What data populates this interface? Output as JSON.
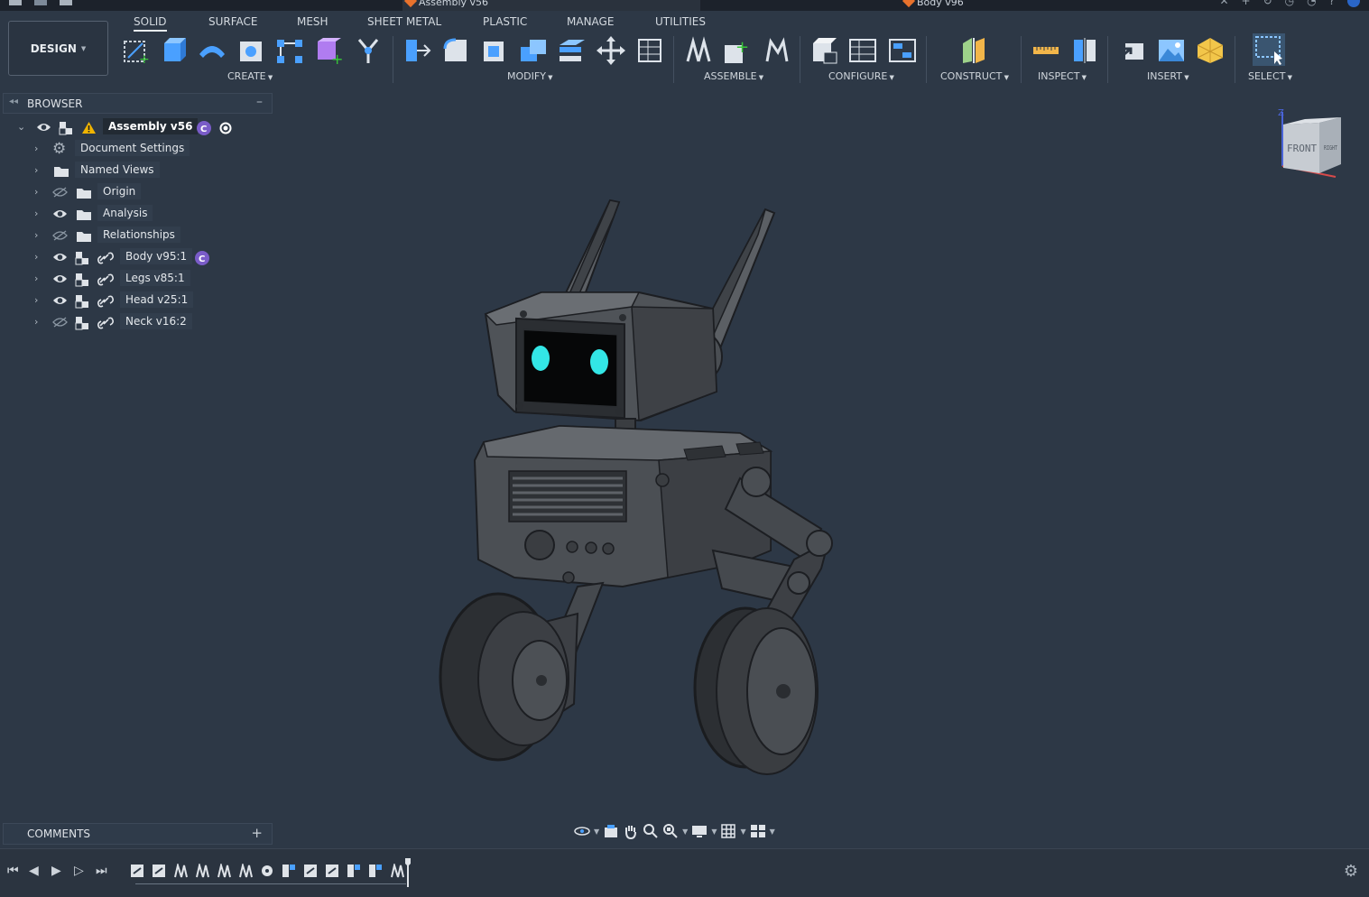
{
  "titlebar": {
    "tabs": [
      {
        "label": "Assembly v56",
        "active": true
      },
      {
        "label": "Body v96",
        "active": false
      }
    ]
  },
  "workspace_button": "DESIGN",
  "ribbon": {
    "tabs": [
      "SOLID",
      "SURFACE",
      "MESH",
      "SHEET METAL",
      "PLASTIC",
      "MANAGE",
      "UTILITIES"
    ],
    "active_tab": "SOLID",
    "groups": {
      "create": "CREATE",
      "modify": "MODIFY",
      "assemble": "ASSEMBLE",
      "configure": "CONFIGURE",
      "construct": "CONSTRUCT",
      "inspect": "INSPECT",
      "insert": "INSERT",
      "select": "SELECT"
    }
  },
  "browser": {
    "title": "BROWSER",
    "root": "Assembly v56",
    "items": [
      {
        "label": "Document Settings",
        "icon": "gear-icon"
      },
      {
        "label": "Named Views",
        "icon": "folder-icon"
      },
      {
        "label": "Origin",
        "icon": "folder-icon",
        "visible": false
      },
      {
        "label": "Analysis",
        "icon": "folder-icon",
        "visible": true
      },
      {
        "label": "Relationships",
        "icon": "folder-icon",
        "visible": false
      },
      {
        "label": "Body v95:1",
        "icon": "component-icon",
        "visible": true
      },
      {
        "label": "Legs v85:1",
        "icon": "component-icon",
        "visible": true
      },
      {
        "label": "Head v25:1",
        "icon": "component-icon",
        "visible": true
      },
      {
        "label": "Neck v16:2",
        "icon": "component-icon",
        "visible": false
      }
    ]
  },
  "comments": {
    "title": "COMMENTS"
  },
  "viewcube": {
    "front": "FRONT",
    "right": "RIGHT",
    "axis_z": "Z"
  },
  "colors": {
    "background": "#2d3846",
    "accent": "#7a5cc8",
    "warning": "#f0b400",
    "eye": "#33e6e6"
  }
}
